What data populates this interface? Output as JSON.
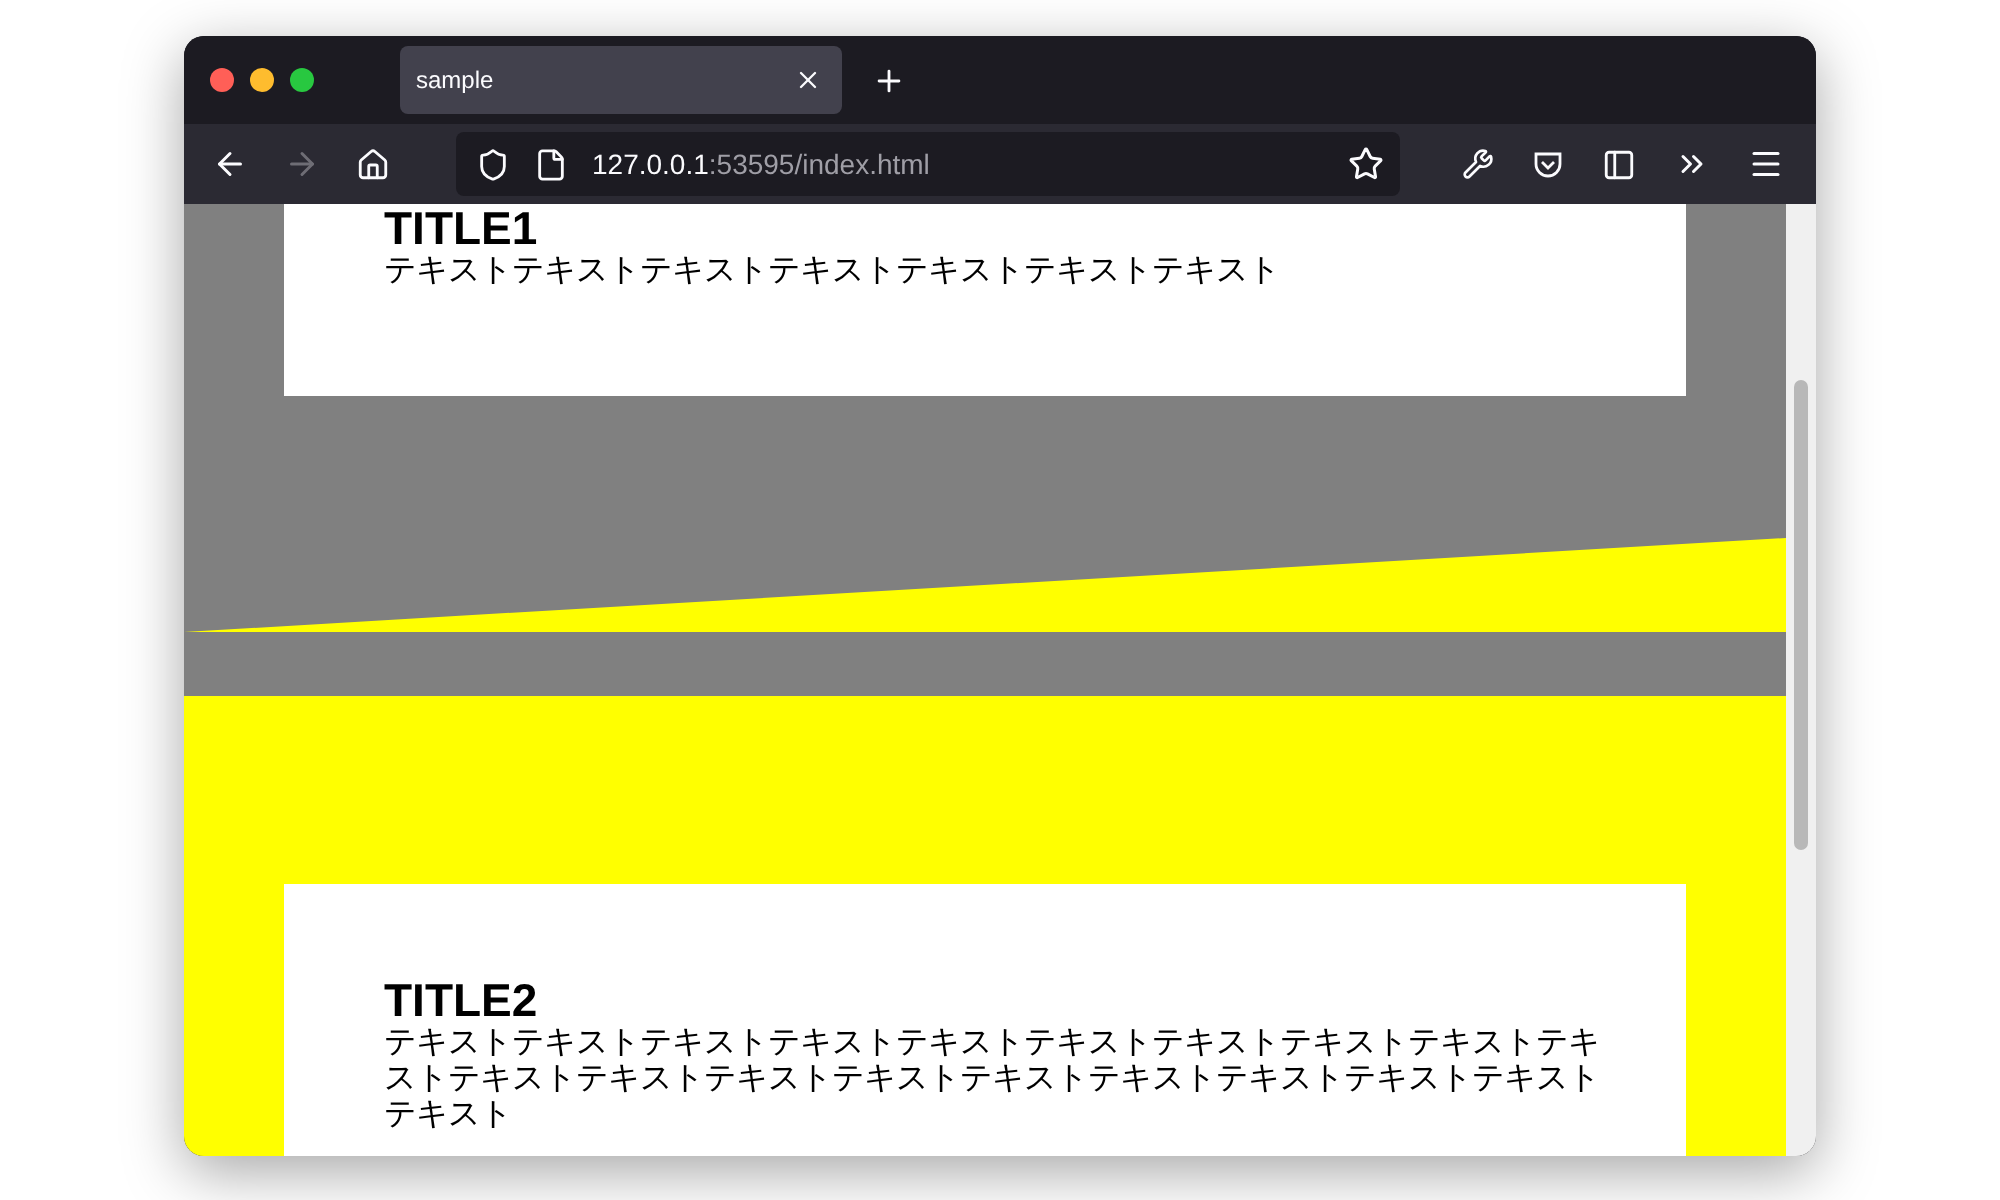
{
  "browser": {
    "tabs": [
      {
        "title": "sample"
      }
    ],
    "url": {
      "host": "127.0.0.1",
      "path": ":53595/index.html"
    }
  },
  "sections": [
    {
      "kind": "slanted",
      "title": "TITLE1",
      "body": "テキストテキストテキストテキストテキストテキストテキスト"
    },
    {
      "kind": "plain",
      "title": "TITLE2",
      "body": "テキストテキストテキストテキストテキストテキストテキストテキストテキストテキストテキストテキストテキストテキストテキストテキストテキストテキストテキストテキスト"
    }
  ]
}
